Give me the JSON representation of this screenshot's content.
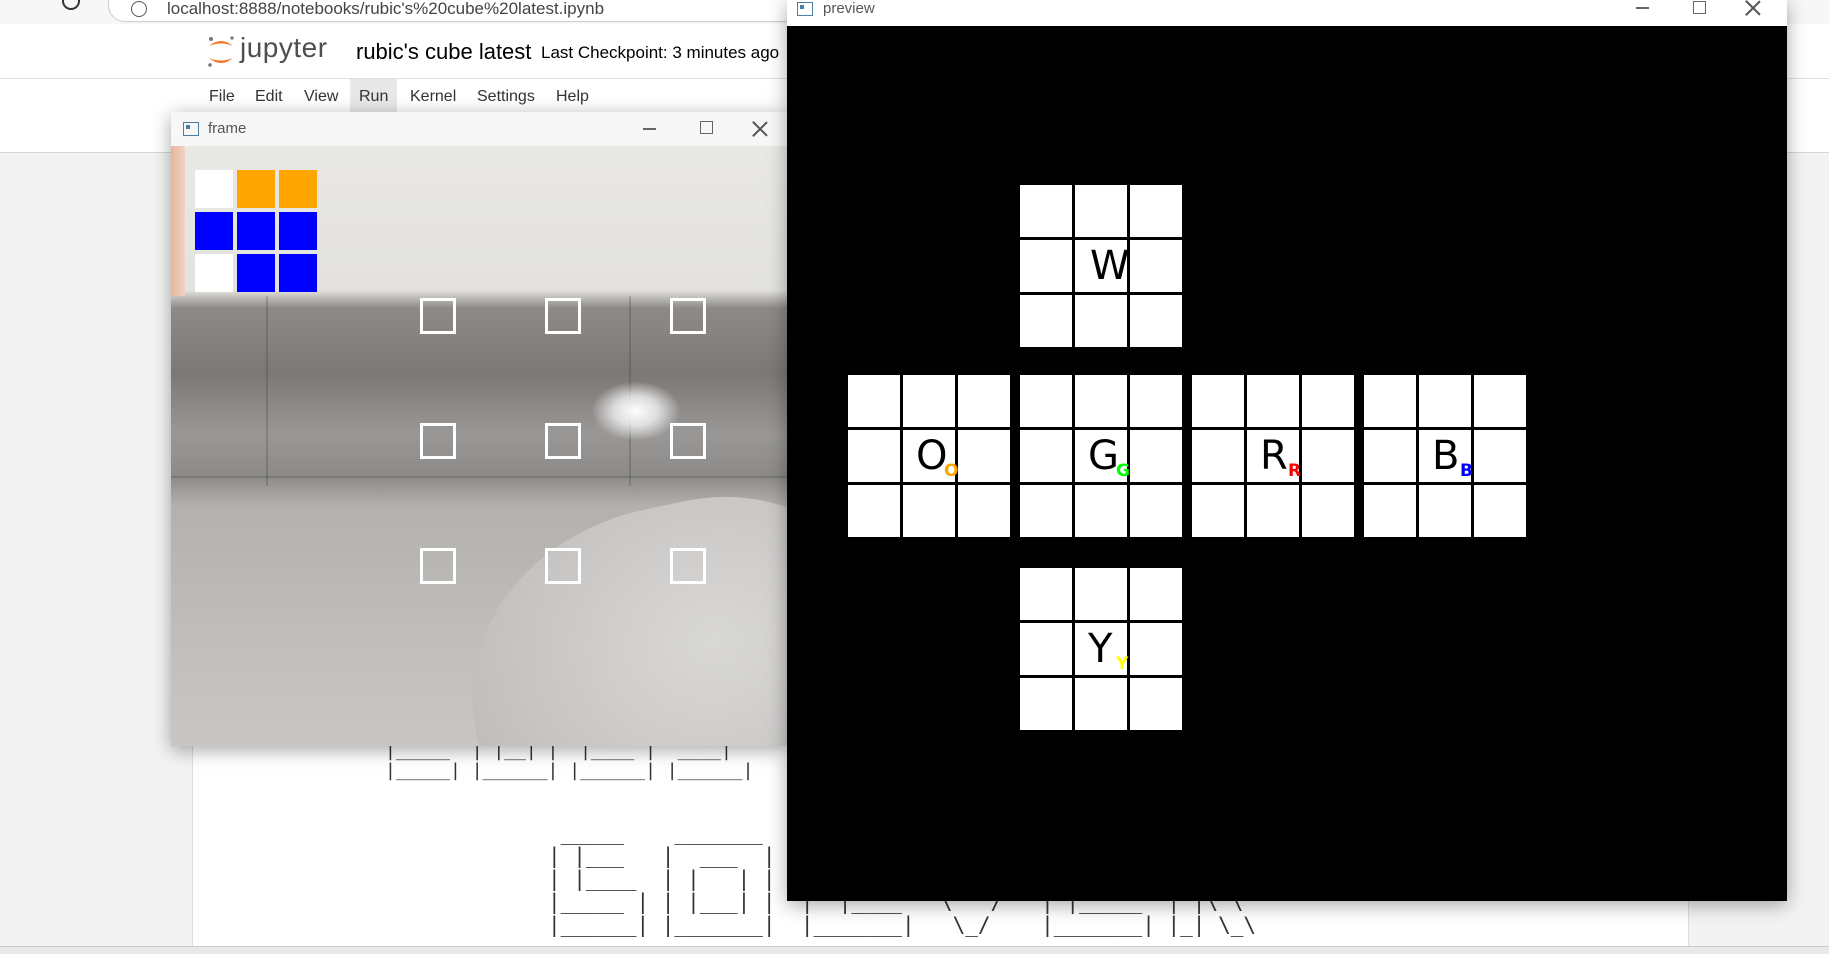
{
  "browser": {
    "url": "localhost:8888/notebooks/rubic's%20cube%20latest.ipynb"
  },
  "jupyter": {
    "logo_text": "jupyter",
    "notebook_title": "rubic's cube latest",
    "checkpoint": "Last Checkpoint: 3 minutes ago",
    "menu": [
      "File",
      "Edit",
      "View",
      "Run",
      "Kernel",
      "Settings",
      "Help"
    ],
    "active_menu": "Run"
  },
  "frame_window": {
    "title": "frame",
    "scanned_face": [
      [
        "white",
        "orange",
        "orange"
      ],
      [
        "blue",
        "blue",
        "blue"
      ],
      [
        "white",
        "blue",
        "blue"
      ]
    ],
    "sticker_colors": {
      "white": "#ffffff",
      "orange": "#ffa500",
      "blue": "#0000ff"
    },
    "detection_grid": {
      "rows": 3,
      "cols": 3
    }
  },
  "preview_window": {
    "title": "preview",
    "faces": [
      {
        "id": "up",
        "label": "W",
        "sub": "",
        "sub_color": ""
      },
      {
        "id": "left",
        "label": "O",
        "sub": "O",
        "sub_color": "#ffa500"
      },
      {
        "id": "front",
        "label": "G",
        "sub": "G",
        "sub_color": "#00ff00"
      },
      {
        "id": "right",
        "label": "R",
        "sub": "R",
        "sub_color": "#ff0000"
      },
      {
        "id": "back",
        "label": "B",
        "sub": "B",
        "sub_color": "#0000ff"
      },
      {
        "id": "down",
        "label": "Y",
        "sub": "Y",
        "sub_color": "#ffff00"
      }
    ]
  },
  "notebook_output": {
    "ascii_line_1": "|_____  | |__| |  |____ |  ____|",
    "ascii_line_2": "|_____| |______| |______| |______|",
    "ascii_block": " _____    _______    __\n| |___   |  ___  |  |  |\n| |____  | |   | |  |  |\n|_____ | | |___| |  |  |____   \\   /   | |_____  | |\\ \\\n|______| |_______|  |_______|   \\_/    |_______| |_| \\_\\"
  },
  "colors": {
    "jupyter_orange": "#f37626",
    "preview_bg": "#000000",
    "cell_white": "#ffffff"
  }
}
